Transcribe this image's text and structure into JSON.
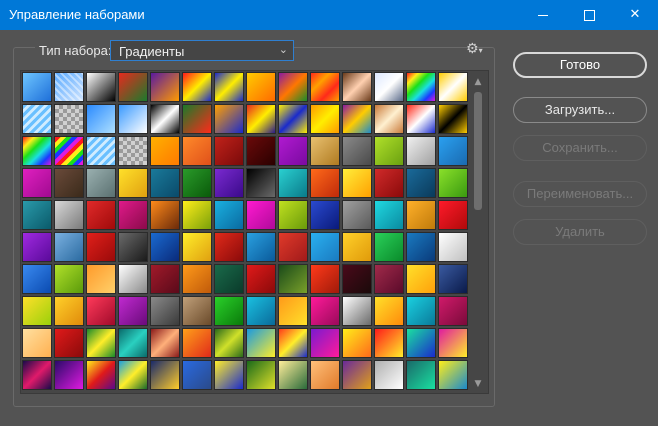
{
  "window": {
    "title": "Управление наборами",
    "minimize_glyph": "",
    "maximize_glyph": "",
    "close_glyph": "✕"
  },
  "set": {
    "label": "Тип набора:",
    "value": "Градиенты",
    "chevron": "⌄",
    "gear": "⚙",
    "gear_caret": "▾"
  },
  "buttons": {
    "done": "Готово",
    "load": "Загрузить...",
    "save": "Сохранить...",
    "rename": "Переименовать...",
    "delete": "Удалить"
  },
  "scroll": {
    "up": "▲",
    "down": "▼"
  },
  "colors": {
    "titlebar": "#0078d7",
    "panel": "#535353",
    "selection_border": "#2f7fd0"
  },
  "swatches": [
    [
      "linear-gradient(135deg,#6ec6ff,#1e6fd9)",
      "CHECKBLUE",
      "linear-gradient(135deg,#ffffff,#000000)",
      "linear-gradient(135deg,#e62a1e,#1b7a2c)",
      "linear-gradient(135deg,#5a1aa0,#ff9a00)",
      "linear-gradient(135deg,#ff1a1a,#ffee00,#1a2acc)",
      "linear-gradient(135deg,#1a2acc,#ffee00,#1a2acc)",
      "linear-gradient(135deg,#ffcc00,#ff6a00)",
      "linear-gradient(135deg,#8a1aa0,#ff7700,#1a8a2a)",
      "linear-gradient(135deg,#ff2a1a,#ffa000,#ff2a1a,#ffa000)",
      "linear-gradient(135deg,#6a3a1a,#ffd0b0,#6a3a1a)",
      "linear-gradient(135deg,#dde8ff,#ffffff,#5a6a8a)",
      "RAINBOW",
      "linear-gradient(135deg,#ffcc00,#ffffff,#ffcc00)"
    ],
    [
      "STRIPEBLUE",
      "CHECKGRAY",
      "linear-gradient(135deg,#2a8aff,#aee0ff)",
      "linear-gradient(135deg,#3a9aff,#ffffff)",
      "linear-gradient(135deg,#000000,#ffffff,#000000)",
      "linear-gradient(135deg,#1a7a2a,#ff2a1a)",
      "linear-gradient(135deg,#ffa000,#1a2acc)",
      "linear-gradient(135deg,#e62a1e,#ffee00,#2a1a8a)",
      "linear-gradient(135deg,#ffee00,#1a2acc,#ffee00)",
      "linear-gradient(135deg,#ff9a00,#ffee00,#ff9a00)",
      "linear-gradient(135deg,#8a1aa0,#ffcc00,#1a8acc)",
      "linear-gradient(135deg,#c87a3a,#fff0d0,#c87a3a)",
      "linear-gradient(135deg,#ff2a1a,#ffffff,#1a2acc)",
      "linear-gradient(135deg,#ffcc00,#000000,#ffcc00)"
    ],
    [
      "RAINBOW",
      "RAINBOW2",
      "STRIPEBLUE",
      "CHECKGRAY",
      "linear-gradient(135deg,#ffb000,#ff7a00)",
      "linear-gradient(135deg,#ff8a2a,#e0501a)",
      "linear-gradient(135deg,#c0221a,#7a0a0a)",
      "linear-gradient(135deg,#6a0a0a,#2a0000)",
      "linear-gradient(135deg,#b01ad0,#7a0aa0)",
      "linear-gradient(135deg,#e8c070,#b07a20)",
      "linear-gradient(135deg,#8a8a8a,#4a4a4a)",
      "linear-gradient(135deg,#b0e02a,#6aa010)",
      "linear-gradient(135deg,#f0f0f0,#a0a0a0)",
      "linear-gradient(135deg,#2aa0f0,#1a6ab0)"
    ],
    [
      "linear-gradient(135deg,#e020c0,#a00a90)",
      "linear-gradient(135deg,#6a4a3a,#3a2a1a)",
      "linear-gradient(135deg,#9ab0b0,#5a7070)",
      "linear-gradient(135deg,#ffe02a,#e0a010)",
      "linear-gradient(135deg,#1a7a9a,#0a4a6a)",
      "linear-gradient(135deg,#2a9a2a,#0a5a0a)",
      "linear-gradient(135deg,#7a2ad0,#3a0a8a)",
      "linear-gradient(135deg,#000000,#6a6a6a)",
      "linear-gradient(135deg,#2ad0d0,#0a7a8a)",
      "linear-gradient(135deg,#ff6a1a,#c02a0a)",
      "linear-gradient(135deg,#ffee3a,#ffa000)",
      "linear-gradient(135deg,#d02a2a,#8a0a0a)",
      "linear-gradient(135deg,#1a6a9a,#0a3a5a)",
      "linear-gradient(135deg,#8ae02a,#3a9a10)"
    ],
    [
      "linear-gradient(135deg,#2a9aaa,#0a5a6a)",
      "linear-gradient(135deg,#d8d8d8,#7a7a7a)",
      "linear-gradient(135deg,#e02a2a,#a00a0a)",
      "linear-gradient(135deg,#e01a8a,#8a0a4a)",
      "linear-gradient(135deg,#ff8a1a,#6a2a0a)",
      "linear-gradient(135deg,#ffee1a,#7aa00a)",
      "linear-gradient(135deg,#1ab0e0,#0a6aa0)",
      "linear-gradient(135deg,#ff1ad0,#b00a9a)",
      "linear-gradient(135deg,#c0e020,#6a9a0a)",
      "linear-gradient(135deg,#2a4ad0,#0a1a7a)",
      "linear-gradient(135deg,#a0a0a0,#5a5a5a)",
      "linear-gradient(135deg,#20d8e0,#0a8aa0)",
      "linear-gradient(135deg,#ffb02a,#c07a0a)",
      "linear-gradient(135deg,#ff1a2a,#b00a0a)"
    ],
    [
      "linear-gradient(135deg,#a02ae0,#5a0a9a)",
      "linear-gradient(135deg,#7ab0e0,#2a6aa0)",
      "linear-gradient(135deg,#e0201a,#9a0a0a)",
      "linear-gradient(135deg,#6a6a6a,#1a1a1a)",
      "linear-gradient(135deg,#1a6ad0,#0a2a7a)",
      "linear-gradient(135deg,#ffee2a,#e0a010)",
      "linear-gradient(135deg,#e02a1a,#8a0a0a)",
      "linear-gradient(135deg,#2aa0e0,#0a5a9a)",
      "linear-gradient(135deg,#e03a2a,#a01a1a)",
      "linear-gradient(135deg,#2ab0f0,#1a7ac0)",
      "linear-gradient(135deg,#ffd02a,#e09a0a)",
      "linear-gradient(135deg,#2ad05a,#0a8a2a)",
      "linear-gradient(135deg,#1a7ac0,#0a3a7a)",
      "linear-gradient(135deg,#ffffff,#c0c0c0)"
    ],
    [
      "linear-gradient(135deg,#3a8af0,#0a4ab0)",
      "linear-gradient(135deg,#b0e02a,#5a9a0a)",
      "linear-gradient(135deg,#ff9a2a,#ffd06a)",
      "linear-gradient(135deg,#ffffff,#8a8a8a)",
      "linear-gradient(135deg,#a01a2a,#5a0a1a)",
      "linear-gradient(135deg,#ff9a1a,#c05a0a)",
      "linear-gradient(135deg,#1a6a4a,#0a3a2a)",
      "linear-gradient(135deg,#e01a1a,#8a0a0a)",
      "linear-gradient(135deg,#1a4a1a,#7aa02a)",
      "linear-gradient(135deg,#ff3a1a,#a01a0a)",
      "linear-gradient(135deg,#4a0a1a,#1a0a0a)",
      "linear-gradient(135deg,#a02a4a,#5a0a2a)",
      "linear-gradient(135deg,#ffe02a,#ffa00a)",
      "linear-gradient(135deg,#3a5aa0,#0a1a4a)"
    ],
    [
      "linear-gradient(135deg,#ffe02a,#9ad00a)",
      "linear-gradient(135deg,#ffd02a,#e08a0a)",
      "linear-gradient(135deg,#ff3a5a,#a00a2a)",
      "linear-gradient(135deg,#c02ad0,#6a0a7a)",
      "linear-gradient(135deg,#8a8a8a,#3a3a3a)",
      "linear-gradient(135deg,#c0a07a,#6a4a2a)",
      "linear-gradient(135deg,#2ad02a,#0a7a0a)",
      "linear-gradient(135deg,#1ac0e0,#0a6a9a)",
      "linear-gradient(135deg,#ff9a1a,#ffe02a)",
      "linear-gradient(135deg,#ff1a9a,#9a0a5a)",
      "linear-gradient(135deg,#ffffff,#6a6a6a)",
      "linear-gradient(135deg,#ffe02a,#ff8a0a)",
      "linear-gradient(135deg,#1ad0e0,#0a7a9a)",
      "linear-gradient(135deg,#d01a6a,#7a0a3a)"
    ],
    [
      "linear-gradient(135deg,#ffe0a0,#ffb050)",
      "linear-gradient(135deg,#e01a1a,#8a0a0a)",
      "linear-gradient(135deg,#1a8a2a,#ffee2a,#1a8a2a)",
      "linear-gradient(135deg,#0a6a6a,#2ad0c0,#0a6a6a)",
      "linear-gradient(135deg,#8a1a1a,#ffb07a,#8a1a1a)",
      "linear-gradient(135deg,#ffa01a,#e02a1a)",
      "linear-gradient(135deg,#2a6a1a,#d0e02a,#2a6a1a)",
      "linear-gradient(135deg,#1a9ae0,#ffee2a)",
      "linear-gradient(135deg,#ff3a1a,#ffee2a,#1a2acc)",
      "linear-gradient(135deg,#7a1ad0,#ff1a9a)",
      "linear-gradient(135deg,#ffee1a,#ff6a1a)",
      "linear-gradient(135deg,#ff1a1a,#ffee2a)",
      "linear-gradient(135deg,#1ae0a0,#1a2acc)",
      "linear-gradient(135deg,#e01aa0,#ffee2a)"
    ],
    [
      "linear-gradient(135deg,#1a0a4a,#e01a6a,#1a0a4a)",
      "linear-gradient(135deg,#2a0a6a,#e01ae0)",
      "linear-gradient(135deg,#ffee1a,#e01a1a,#5a0a8a)",
      "linear-gradient(135deg,#1aa0e0,#ffee2a,#1a6a2a)",
      "linear-gradient(135deg,#1a2a6a,#ffcc2a)",
      "linear-gradient(135deg,#2a6ae0,#2a4a8a)",
      "linear-gradient(135deg,#ffee2a,#1a2acc)",
      "linear-gradient(135deg,#1a6a1a,#e0e02a)",
      "linear-gradient(135deg,#ffee9a,#2a6a3a)",
      "linear-gradient(135deg,#ffc07a,#e07a2a)",
      "linear-gradient(135deg,#6a2a9a,#e0a01a)",
      "linear-gradient(135deg,#b0b0b0,#ffffff)",
      "linear-gradient(135deg,#1a6a6a,#1ae0a0)",
      "linear-gradient(135deg,#ffee1a,#1a8acc)"
    ]
  ]
}
